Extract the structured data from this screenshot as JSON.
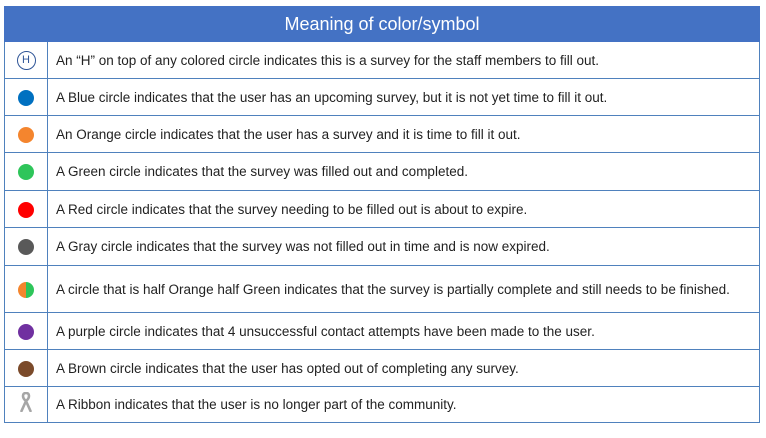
{
  "table": {
    "title": "Meaning of color/symbol",
    "rows": [
      {
        "symbol": {
          "icon": "h-circle-icon",
          "letter": "H",
          "color": "#2f5597"
        },
        "text": "An “H” on top of any colored circle indicates this is a survey for the staff members to fill out."
      },
      {
        "symbol": {
          "icon": "blue-circle-icon",
          "color": "#0070c0"
        },
        "text": "A Blue circle indicates that the user has an upcoming survey, but it is not yet time to fill it out."
      },
      {
        "symbol": {
          "icon": "orange-circle-icon",
          "color": "#f4852e"
        },
        "text": "An Orange circle indicates that the user has a survey and it is time to fill it out."
      },
      {
        "symbol": {
          "icon": "green-circle-icon",
          "color": "#2ec55a"
        },
        "text": "A Green circle indicates that the survey was filled out and completed."
      },
      {
        "symbol": {
          "icon": "red-circle-icon",
          "color": "#ff0000"
        },
        "text": "A Red circle indicates that the survey needing to be filled out is about to expire."
      },
      {
        "symbol": {
          "icon": "gray-circle-icon",
          "color": "#595959"
        },
        "text": "A Gray circle indicates that the survey was not filled out in time and is now expired."
      },
      {
        "symbol": {
          "icon": "orange-green-half-circle-icon",
          "color_left": "#f4852e",
          "color_right": "#2ec55a"
        },
        "text": "A circle that is half Orange half Green indicates that the survey is partially complete and still needs to be finished."
      },
      {
        "symbol": {
          "icon": "purple-circle-icon",
          "color": "#7030a0"
        },
        "text": "A purple circle indicates that 4 unsuccessful contact attempts have been made to the user."
      },
      {
        "symbol": {
          "icon": "brown-circle-icon",
          "color": "#7b4a2a"
        },
        "text": "A Brown circle indicates that the user has opted out of completing any survey."
      },
      {
        "symbol": {
          "icon": "ribbon-icon",
          "color": "#a6a6a6"
        },
        "text": "A Ribbon indicates that the user is no longer part of the community."
      }
    ]
  }
}
